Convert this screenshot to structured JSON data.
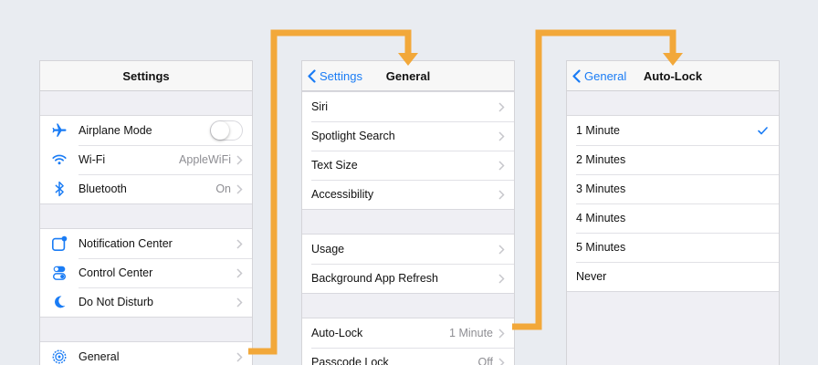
{
  "colors": {
    "accent": "#1a7cf5",
    "connector": "#f2a83a",
    "background": "#e9ecf1"
  },
  "settings_panel": {
    "title": "Settings",
    "groups": [
      [
        {
          "icon": "airplane-icon",
          "label": "Airplane Mode",
          "control": "toggle",
          "toggle_on": false
        },
        {
          "icon": "wifi-icon",
          "label": "Wi-Fi",
          "value": "AppleWiFi"
        },
        {
          "icon": "bluetooth-icon",
          "label": "Bluetooth",
          "value": "On"
        }
      ],
      [
        {
          "icon": "notification-center-icon",
          "label": "Notification Center"
        },
        {
          "icon": "control-center-icon",
          "label": "Control Center"
        },
        {
          "icon": "moon-icon",
          "label": "Do Not Disturb"
        }
      ],
      [
        {
          "icon": "gear-icon",
          "label": "General"
        }
      ]
    ]
  },
  "general_panel": {
    "back_label": "Settings",
    "title": "General",
    "groups": [
      [
        {
          "label": "Siri"
        },
        {
          "label": "Spotlight Search"
        },
        {
          "label": "Text Size"
        },
        {
          "label": "Accessibility"
        }
      ],
      [
        {
          "label": "Usage"
        },
        {
          "label": "Background App Refresh"
        }
      ],
      [
        {
          "label": "Auto-Lock",
          "value": "1 Minute"
        },
        {
          "label": "Passcode Lock",
          "value": "Off"
        }
      ]
    ]
  },
  "autolock_panel": {
    "back_label": "General",
    "title": "Auto-Lock",
    "options": [
      {
        "label": "1 Minute",
        "selected": true
      },
      {
        "label": "2 Minutes",
        "selected": false
      },
      {
        "label": "3 Minutes",
        "selected": false
      },
      {
        "label": "4 Minutes",
        "selected": false
      },
      {
        "label": "5 Minutes",
        "selected": false
      },
      {
        "label": "Never",
        "selected": false
      }
    ]
  }
}
